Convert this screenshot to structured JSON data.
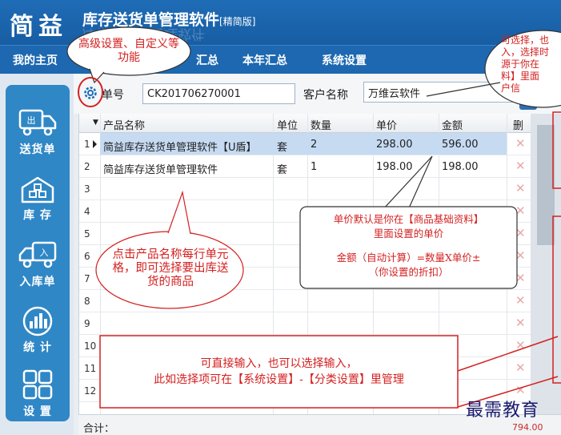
{
  "app": {
    "logo": "简益",
    "title": "库存送货单管理软件",
    "edition": "[精简版]"
  },
  "nav": [
    "我的主页",
    "汇总",
    "本年汇总",
    "系统设置"
  ],
  "sidebar": [
    {
      "label": "送货单",
      "icon": "truck-icon",
      "badge": "出"
    },
    {
      "label": "库 存",
      "icon": "warehouse-icon"
    },
    {
      "label": "入库单",
      "icon": "truck-in-icon",
      "badge": "入"
    },
    {
      "label": "统 计",
      "icon": "bar-chart-icon"
    },
    {
      "label": "设 置",
      "icon": "grid-icon"
    }
  ],
  "form": {
    "order_no_label": "单号",
    "order_no_value": "CK201706270001",
    "customer_label": "客户名称",
    "customer_value": "万维云软件"
  },
  "grid": {
    "columns": [
      "产品名称",
      "单位",
      "数量",
      "单价",
      "金额",
      "删"
    ],
    "rows": [
      {
        "num": "1",
        "name": "简益库存送货单管理软件【U盾】",
        "unit": "套",
        "qty": "2",
        "price": "298.00",
        "amount": "596.00",
        "selected": true
      },
      {
        "num": "2",
        "name": "简益库存送货单管理软件",
        "unit": "套",
        "qty": "1",
        "price": "198.00",
        "amount": "198.00"
      },
      {
        "num": "3"
      },
      {
        "num": "4"
      },
      {
        "num": "5"
      },
      {
        "num": "6"
      },
      {
        "num": "7"
      },
      {
        "num": "8"
      },
      {
        "num": "9"
      },
      {
        "num": "10"
      },
      {
        "num": "11"
      },
      {
        "num": "12"
      }
    ],
    "delete_glyph": "✕"
  },
  "footer": {
    "total_label": "合计：",
    "total_value": "794.00"
  },
  "annotations": {
    "gear_callout": "高级设置、自定义等功能",
    "customer_callout": "可选择，也可输入，选择时数据来源于你在【客户资料】里面设置的客户信息",
    "customer_callout_visible": "可选择，也\n入，选择时\n源于你在\n料】里面\n户信",
    "price_callout_line1": "单价默认是你在【商品基础资料】",
    "price_callout_line2": "里面设置的单价",
    "price_callout_line3": "金额（自动计算）=数量X单价±",
    "price_callout_line4": "（你设置的折扣）",
    "product_callout": "点击产品名称每行单元格，即可选择要出库送货的商品",
    "unit_box_line1": "可直接输入，也可以选择输入，",
    "unit_box_line2": "此如选择项可在【系统设置】-【分类设置】里管理",
    "watermark": "最需教育"
  },
  "colors": {
    "header_blue": "#1d68b0",
    "sidebar_blue": "#2f87c6",
    "selected_row": "#c6dbf2",
    "annotation_red": "#d42020"
  }
}
